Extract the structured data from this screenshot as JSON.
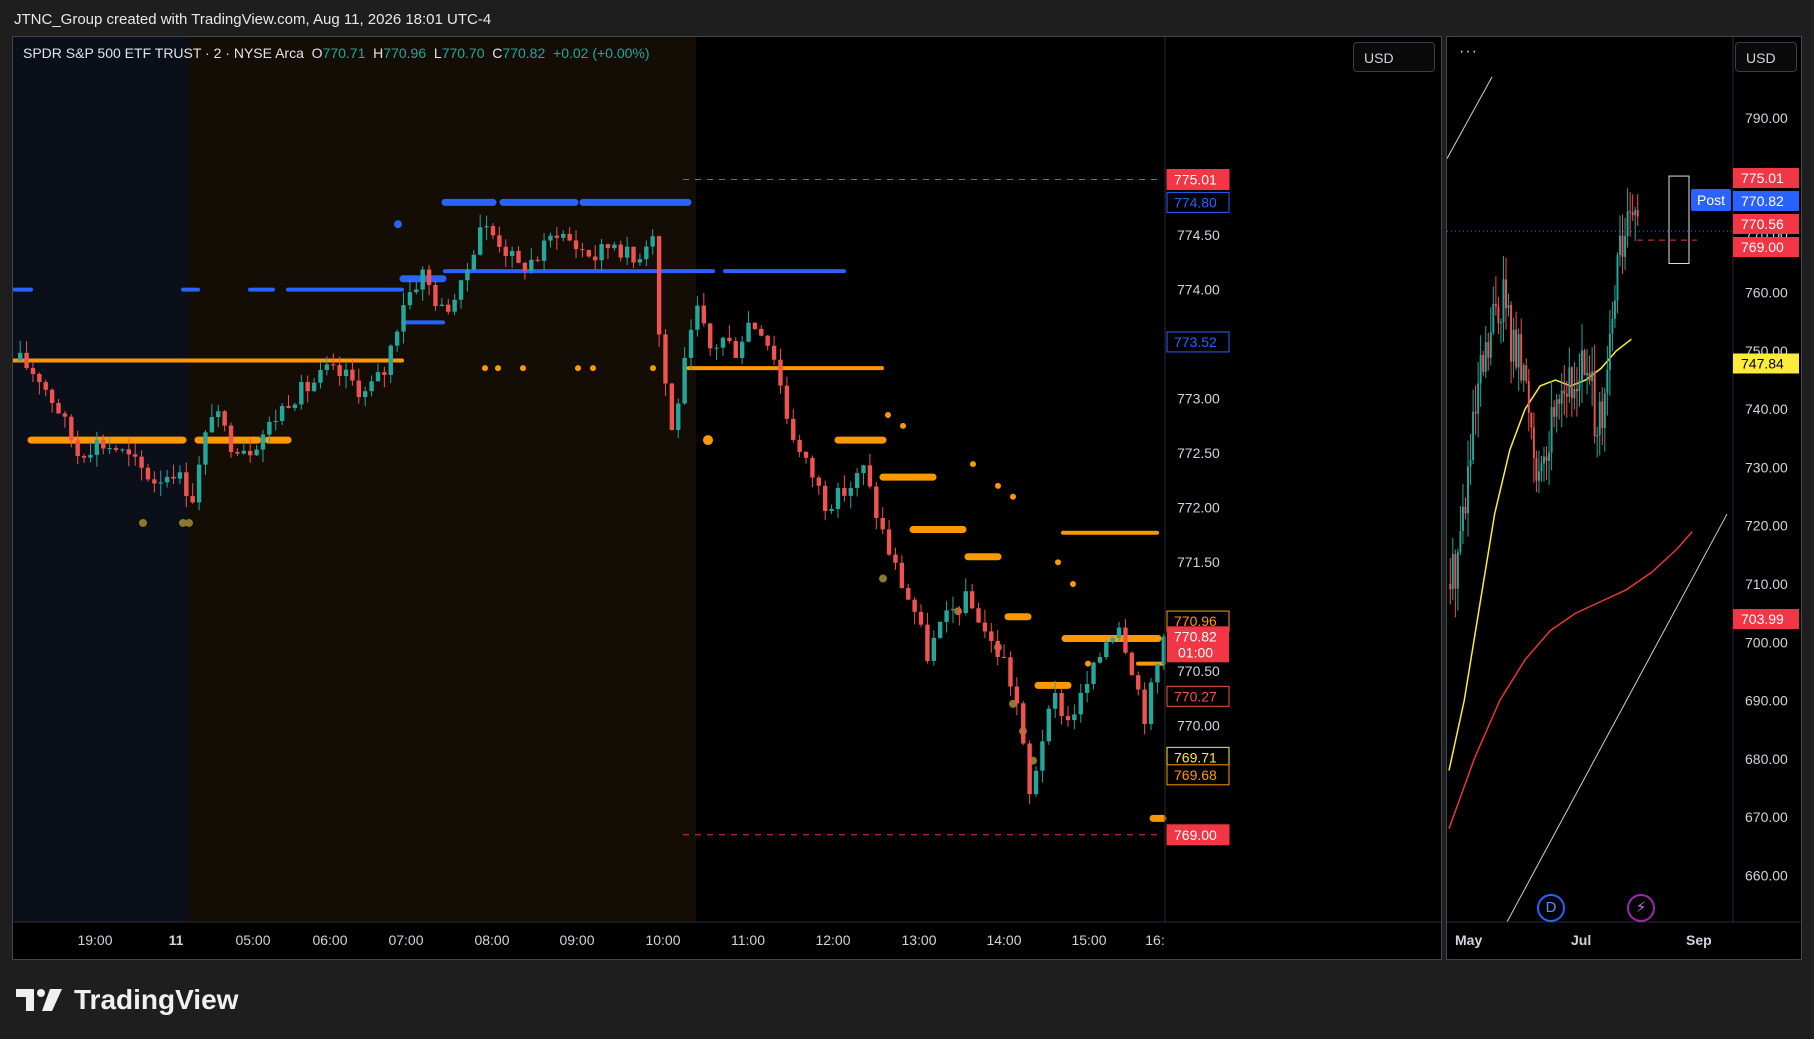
{
  "header": {
    "text": "JTNC_Group created with TradingView.com, Aug 11, 2026 18:01 UTC-4"
  },
  "legend": {
    "symbol": "SPDR S&P 500 ETF TRUST · 2 · NYSE Arca",
    "o_label": "O",
    "o_value": "770.71",
    "h_label": "H",
    "h_value": "770.96",
    "l_label": "L",
    "l_value": "770.70",
    "c_label": "C",
    "c_value": "770.82",
    "change": "+0.02 (+0.00%)"
  },
  "currency": "USD",
  "colors": {
    "up": "#26a69a",
    "down": "#ef5350",
    "orange": "#ff9800",
    "blue": "#2962ff",
    "olive": "#8a7a2a",
    "yellow": "#ffeb3b",
    "red_line": "#e53935",
    "session_pre": "#0b0f1a",
    "session_ext": "#140d05"
  },
  "chart_data": [
    {
      "type": "candlestick",
      "name_ref": "SPY 2-minute intraday",
      "ylim": [
        768.2,
        775.95
      ],
      "y_ticks": [
        770.0,
        770.5,
        771.0,
        771.5,
        772.0,
        772.5,
        773.0,
        773.5,
        774.0,
        774.5
      ],
      "y_tick_labels": [
        "770.00",
        "770.50",
        "771.00",
        "771.50",
        "772.00",
        "772.50",
        "773.00",
        "773.50",
        "774.00",
        "774.50"
      ],
      "x_ticks": [
        "19:00",
        "11",
        "05:00",
        "06:00",
        "07:00",
        "08:00",
        "09:00",
        "10:00",
        "11:00",
        "12:00",
        "13:00",
        "14:00",
        "15:00",
        "16:"
      ],
      "price_path": [
        [
          0,
          773.35
        ],
        [
          3,
          773.2
        ],
        [
          6,
          772.9
        ],
        [
          9,
          772.5
        ],
        [
          12,
          772.6
        ],
        [
          15,
          772.55
        ],
        [
          18,
          772.4
        ],
        [
          21,
          772.25
        ],
        [
          24,
          772.35
        ],
        [
          27,
          772.1
        ],
        [
          30,
          772.9
        ],
        [
          33,
          772.6
        ],
        [
          36,
          772.55
        ],
        [
          39,
          772.75
        ],
        [
          42,
          773.0
        ],
        [
          45,
          773.1
        ],
        [
          48,
          773.25
        ],
        [
          51,
          773.2
        ],
        [
          54,
          773.05
        ],
        [
          57,
          773.25
        ],
        [
          60,
          773.9
        ],
        [
          63,
          774.15
        ],
        [
          66,
          773.8
        ],
        [
          69,
          774.0
        ],
        [
          72,
          774.6
        ],
        [
          75,
          774.45
        ],
        [
          78,
          774.2
        ],
        [
          81,
          774.3
        ],
        [
          84,
          774.55
        ],
        [
          87,
          774.4
        ],
        [
          90,
          774.3
        ],
        [
          93,
          774.45
        ],
        [
          96,
          774.25
        ],
        [
          99,
          774.55
        ],
        [
          100,
          773.6
        ],
        [
          102,
          772.7
        ],
        [
          104,
          773.3
        ],
        [
          106,
          773.8
        ],
        [
          108,
          773.45
        ],
        [
          110,
          773.55
        ],
        [
          112,
          773.45
        ],
        [
          114,
          773.7
        ],
        [
          116,
          773.65
        ],
        [
          118,
          773.4
        ],
        [
          120,
          772.85
        ],
        [
          122,
          772.5
        ],
        [
          124,
          772.3
        ],
        [
          126,
          772.05
        ],
        [
          128,
          772.1
        ],
        [
          130,
          772.2
        ],
        [
          132,
          772.35
        ],
        [
          134,
          771.95
        ],
        [
          136,
          771.6
        ],
        [
          138,
          771.3
        ],
        [
          140,
          771.05
        ],
        [
          142,
          770.65
        ],
        [
          144,
          770.9
        ],
        [
          146,
          771.05
        ],
        [
          148,
          771.15
        ],
        [
          150,
          771.0
        ],
        [
          152,
          770.75
        ],
        [
          154,
          770.6
        ],
        [
          156,
          770.2
        ],
        [
          158,
          769.35
        ],
        [
          160,
          769.9
        ],
        [
          162,
          770.25
        ],
        [
          164,
          770.05
        ],
        [
          166,
          770.25
        ],
        [
          168,
          770.5
        ],
        [
          170,
          770.8
        ],
        [
          172,
          770.95
        ],
        [
          174,
          770.55
        ],
        [
          176,
          770.1
        ],
        [
          178,
          770.55
        ],
        [
          179,
          770.82
        ]
      ],
      "price_labels": [
        "775.01",
        "774.80",
        "773.52",
        "770.96",
        "770.82",
        "01:00",
        "770.27",
        "769.71",
        "769.68",
        "769.00"
      ],
      "levels": {
        "dashed_high": 775.01,
        "dashed_low": 769.0
      }
    },
    {
      "type": "candlestick",
      "name_ref": "SPY daily (mini)",
      "ylim": [
        652,
        797
      ],
      "y_ticks": [
        660,
        670,
        680,
        690,
        700,
        710,
        720,
        730,
        740,
        750,
        760,
        770,
        780,
        790
      ],
      "y_tick_labels": [
        "660.00",
        "670.00",
        "680.00",
        "690.00",
        "700.00",
        "710.00",
        "720.00",
        "730.00",
        "740.00",
        "750.00",
        "760.00",
        "770.00",
        "780.00",
        "790.00"
      ],
      "x_ticks": [
        "May",
        "Jul",
        "Sep"
      ],
      "price_path": [
        [
          0,
          710
        ],
        [
          3,
          716
        ],
        [
          6,
          725
        ],
        [
          9,
          735
        ],
        [
          12,
          745
        ],
        [
          15,
          750
        ],
        [
          18,
          757
        ],
        [
          21,
          760
        ],
        [
          24,
          752
        ],
        [
          27,
          748
        ],
        [
          30,
          744
        ],
        [
          33,
          735
        ],
        [
          36,
          726
        ],
        [
          39,
          735
        ],
        [
          42,
          744
        ],
        [
          45,
          745
        ],
        [
          48,
          742
        ],
        [
          51,
          748
        ],
        [
          54,
          745
        ],
        [
          57,
          740
        ],
        [
          60,
          735
        ],
        [
          63,
          750
        ],
        [
          66,
          765
        ],
        [
          69,
          770
        ],
        [
          72,
          773
        ],
        [
          74,
          770
        ]
      ],
      "ma_yellow": [
        [
          0,
          678
        ],
        [
          6,
          690
        ],
        [
          12,
          706
        ],
        [
          18,
          722
        ],
        [
          24,
          733
        ],
        [
          30,
          740
        ],
        [
          36,
          744
        ],
        [
          42,
          745
        ],
        [
          48,
          744
        ],
        [
          54,
          745
        ],
        [
          60,
          747
        ],
        [
          66,
          750
        ],
        [
          72,
          752
        ]
      ],
      "ma_red": [
        [
          0,
          668
        ],
        [
          10,
          680
        ],
        [
          20,
          690
        ],
        [
          30,
          697
        ],
        [
          40,
          702
        ],
        [
          50,
          705
        ],
        [
          60,
          707
        ],
        [
          70,
          709
        ],
        [
          80,
          712
        ],
        [
          90,
          716
        ],
        [
          96,
          719
        ]
      ],
      "price_labels": [
        "775.01",
        "770.82",
        "770.56",
        "769.00",
        "747.84",
        "703.99"
      ],
      "post_label": "Post"
    }
  ]
}
